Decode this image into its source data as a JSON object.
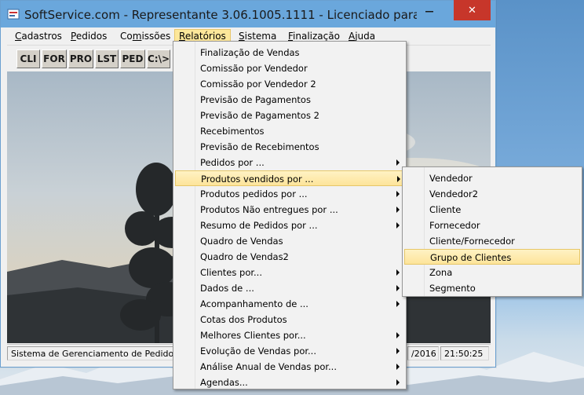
{
  "window": {
    "title": "SoftService.com - Representante 3.06.1005.1111 - Licenciado para softser...",
    "close_symbol": "✕"
  },
  "menubar": [
    {
      "label": "Cadastros"
    },
    {
      "label": "Pedidos"
    },
    {
      "label": "Comissões"
    },
    {
      "label": "Relatórios"
    },
    {
      "label": "Sistema"
    },
    {
      "label": "Finalização"
    },
    {
      "label": "Ajuda"
    }
  ],
  "toolbar": [
    "CLI",
    "FOR",
    "PRO",
    "LST",
    "PED",
    "C:\\>"
  ],
  "status": {
    "left": "Sistema de Gerenciamento de Pedidos",
    "date": "/2016",
    "time": "21:50:25"
  },
  "relatorios_menu": [
    {
      "label": "Finalização de Vendas",
      "submenu": false
    },
    {
      "label": "Comissão por Vendedor",
      "submenu": false
    },
    {
      "label": "Comissão por Vendedor 2",
      "submenu": false
    },
    {
      "label": "Previsão de Pagamentos",
      "submenu": false
    },
    {
      "label": "Previsão de Pagamentos 2",
      "submenu": false
    },
    {
      "label": "Recebimentos",
      "submenu": false
    },
    {
      "label": "Previsão de Recebimentos",
      "submenu": false
    },
    {
      "label": "Pedidos por ...",
      "submenu": true
    },
    {
      "label": "Produtos vendidos por ...",
      "submenu": true,
      "highlighted": true
    },
    {
      "label": "Produtos pedidos por ...",
      "submenu": true
    },
    {
      "label": "Produtos Não entregues por ...",
      "submenu": true
    },
    {
      "label": "Resumo de Pedidos por ...",
      "submenu": true
    },
    {
      "label": "Quadro de Vendas",
      "submenu": false
    },
    {
      "label": "Quadro de Vendas2",
      "submenu": false
    },
    {
      "label": "Clientes por...",
      "submenu": true
    },
    {
      "label": "Dados de ...",
      "submenu": true
    },
    {
      "label": "Acompanhamento de ...",
      "submenu": true
    },
    {
      "label": "Cotas dos Produtos",
      "submenu": false
    },
    {
      "label": "Melhores Clientes por...",
      "submenu": true
    },
    {
      "label": "Evolução de Vendas por...",
      "submenu": true
    },
    {
      "label": "Análise Anual de Vendas por...",
      "submenu": true
    },
    {
      "label": "Agendas...",
      "submenu": true
    }
  ],
  "produtos_vendidos_submenu": [
    {
      "label": "Vendedor"
    },
    {
      "label": "Vendedor2"
    },
    {
      "label": "Cliente"
    },
    {
      "label": "Fornecedor"
    },
    {
      "label": "Cliente/Fornecedor"
    },
    {
      "label": "Grupo de Clientes",
      "highlighted": true
    },
    {
      "label": "Zona"
    },
    {
      "label": "Segmento"
    }
  ],
  "colors": {
    "titlebar": "#6aa7dc",
    "close_button": "#c7362a",
    "menu_highlight": "#fde49a"
  }
}
